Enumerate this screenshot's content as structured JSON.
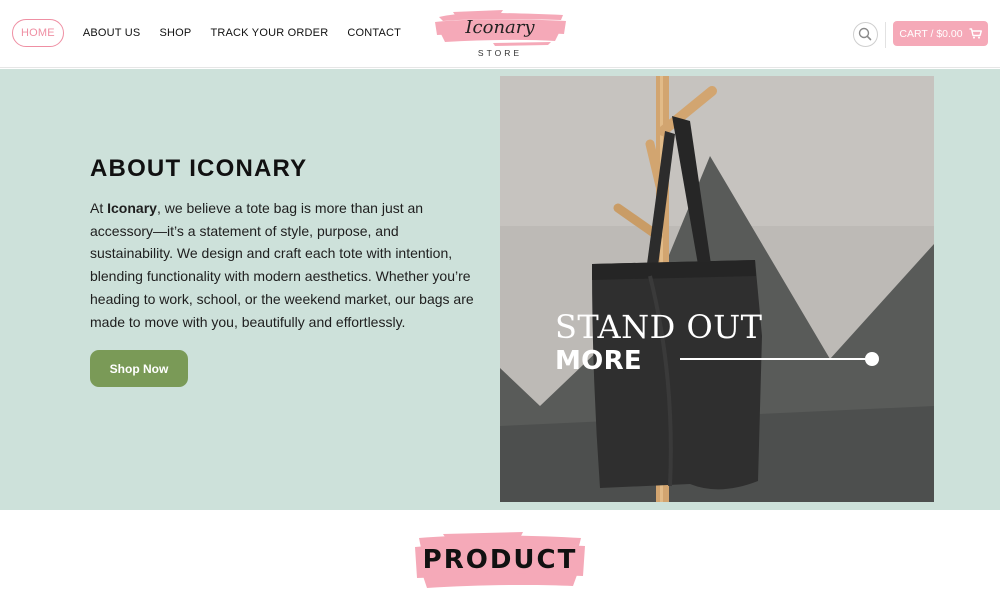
{
  "nav": {
    "items": [
      {
        "label": "HOME",
        "active": true
      },
      {
        "label": "ABOUT US",
        "active": false
      },
      {
        "label": "SHOP",
        "active": false
      },
      {
        "label": "TRACK YOUR ORDER",
        "active": false
      },
      {
        "label": "CONTACT",
        "active": false
      }
    ]
  },
  "logo": {
    "word": "Iconary",
    "sub": "STORE"
  },
  "header": {
    "search_icon": "search-icon",
    "cart_label": "CART / $0.00",
    "cart_icon": "cart-icon"
  },
  "about": {
    "title": "ABOUT ICONARY",
    "text_prefix": "At ",
    "brand": "Iconary",
    "text_rest": ", we believe a tote bag is more than just an accessory—it’s a statement of style, purpose, and sustainability. We design and craft each tote with intention, blending functionality with modern aesthetics. Whether you’re heading to work, school, or the weekend market, our bags are made to move with you, beautifully and effortlessly.",
    "button_label": "Shop Now"
  },
  "hero_image": {
    "overlay_line1": "STAND OUT",
    "overlay_line2": "MORE"
  },
  "product": {
    "heading": "PRODUCT"
  },
  "colors": {
    "accent_pink": "#f5a9b8",
    "hero_bg": "#cde1da",
    "button_green": "#7a9a57"
  }
}
